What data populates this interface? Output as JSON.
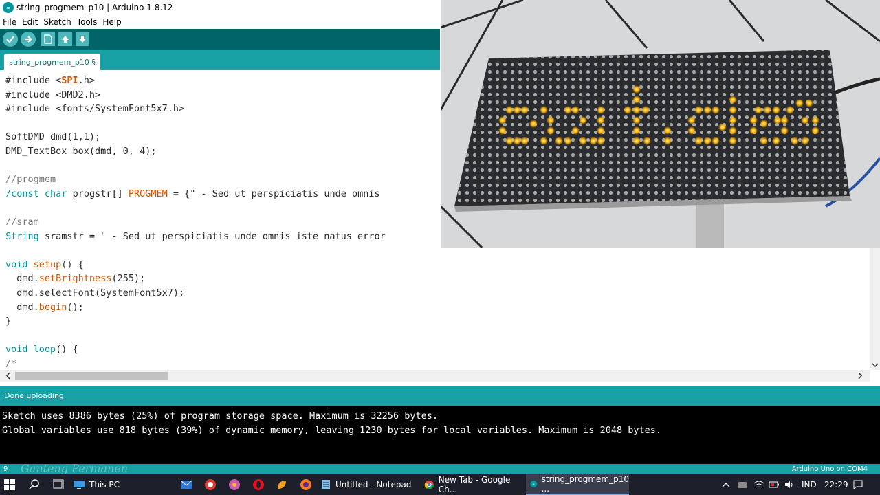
{
  "window": {
    "title": "string_progmem_p10 | Arduino 1.8.12"
  },
  "menu": [
    "File",
    "Edit",
    "Sketch",
    "Tools",
    "Help"
  ],
  "toolbar": {
    "buttons": [
      "verify-icon",
      "upload-icon",
      "new-icon",
      "open-icon",
      "save-icon"
    ]
  },
  "tab": {
    "label": "string_progmem_p10 §"
  },
  "code": {
    "lines": [
      [
        "#include <",
        "SPI",
        ".h>"
      ],
      "#include <DMD2.h>",
      "#include <fonts/SystemFont5x7.h>",
      "",
      "SoftDMD dmd(1,1);",
      "DMD_TextBox box(dmd, 0, 4);",
      "",
      "//progmem",
      [
        "/",
        "const",
        " ",
        "char",
        " progstr[] ",
        "PROGMEM",
        " = {\" - Sed ut perspiciatis unde omnis"
      ],
      "",
      "//sram",
      [
        "String",
        " sramstr = \" - Sed ut perspiciatis unde omnis iste natus error"
      ],
      "",
      [
        "void",
        " ",
        "setup",
        "() {"
      ],
      [
        "  dmd.",
        "setBrightness",
        "(255);"
      ],
      "  dmd.selectFont(SystemFont5x7);",
      [
        "  dmd.",
        "begin",
        "();"
      ],
      "}",
      "",
      [
        "void",
        " ",
        "loop",
        "() {"
      ],
      "/*"
    ]
  },
  "status": {
    "message": "Done uploading"
  },
  "console": {
    "lines": [
      "Sketch uses 8386 bytes (25%) of program storage space. Maximum is 32256 bytes.",
      "Global variables use 818 bytes (39%) of dynamic memory, leaving 1230 bytes for local variables. Maximum is 2048 bytes."
    ]
  },
  "footer": {
    "line_number": "9",
    "watermark": "Ganteng Permanen",
    "board": "Arduino Uno on COM4"
  },
  "taskbar": {
    "items": [
      {
        "label": "This PC",
        "icon": "folder-pc-icon"
      },
      {
        "label": "Untitled - Notepad",
        "icon": "notepad-icon"
      },
      {
        "label": "New Tab - Google Ch...",
        "icon": "chrome-icon"
      },
      {
        "label": "string_progmem_p10 ...",
        "icon": "arduino-icon"
      }
    ],
    "language": "IND",
    "time": "22:29"
  },
  "colors": {
    "teal_dark": "#006468",
    "teal": "#17a1a5",
    "keyword": "#d35400",
    "type": "#00979c",
    "led": "#ffb000"
  }
}
